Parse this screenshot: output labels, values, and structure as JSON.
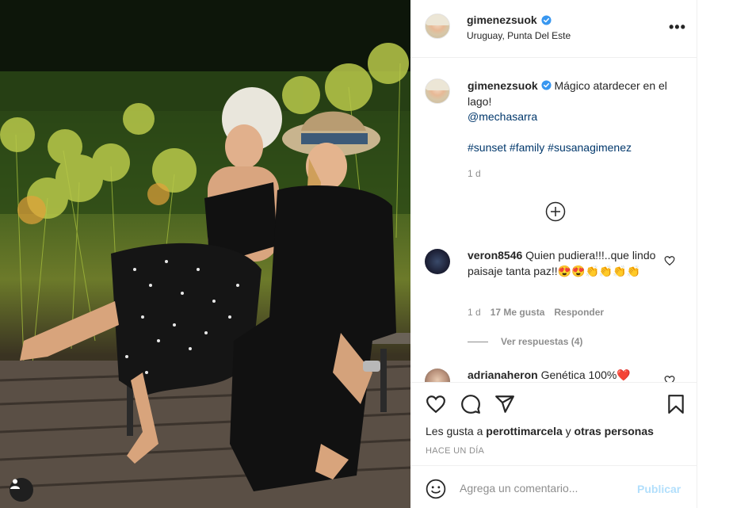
{
  "post": {
    "username": "gimenezsuok",
    "location": "Uruguay, Punta Del Este",
    "verified_icon": "verified-badge-icon",
    "more_icon": "more-options-icon",
    "more_label": "•••"
  },
  "caption": {
    "username": "gimenezsuok",
    "text": "Mágico atardecer en el lago!",
    "mention": "@mechasarra",
    "hashtags": "#sunset #family #susanagimenez",
    "time": "1 d"
  },
  "comments": [
    {
      "username": "veron8546",
      "text": "Quien pudiera!!!..que lindo paisaje tanta paz!!😍😍👏👏👏👏",
      "time": "1 d",
      "likes": "17 Me gusta",
      "reply": "Responder",
      "view_replies": "Ver respuestas (4)"
    },
    {
      "username": "adrianaheron",
      "text": "Genética 100%❤️"
    }
  ],
  "actions": {
    "like_icon": "heart-icon",
    "comment_icon": "comment-icon",
    "share_icon": "paper-plane-icon",
    "save_icon": "bookmark-icon",
    "likes_prefix": "Les gusta a ",
    "likes_user": "perottimarcela",
    "likes_middle": " y ",
    "likes_others": "otras personas",
    "date": "HACE UN DÍA"
  },
  "comment_box": {
    "placeholder": "Agrega un comentario...",
    "post_label": "Publicar",
    "emoji_icon": "emoji-smile-icon"
  },
  "colors": {
    "link": "#00376b",
    "verified": "#3897f0",
    "muted": "#8e8e8e",
    "post_disabled": "#b2dffc"
  }
}
